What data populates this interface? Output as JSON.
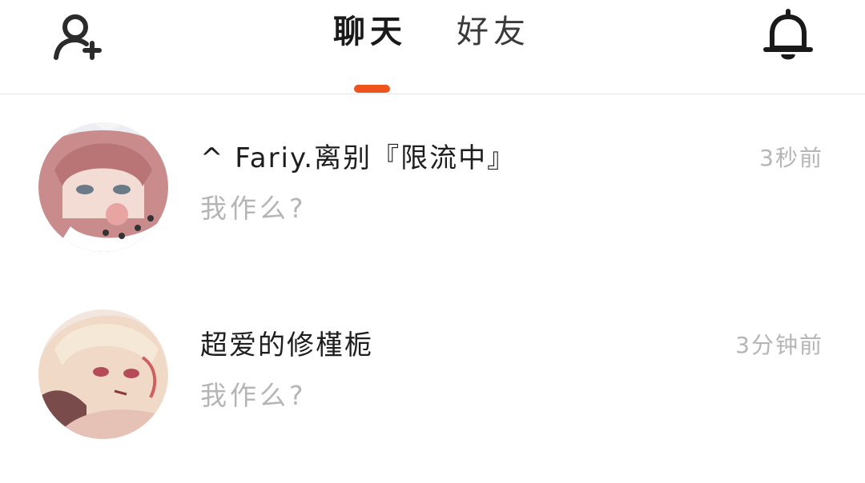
{
  "header": {
    "add_friend_icon": "user-plus-icon",
    "notification_icon": "bell-icon",
    "tabs": [
      {
        "label": "聊天",
        "active": true
      },
      {
        "label": "好友",
        "active": false
      }
    ],
    "accent_color": "#f0541e"
  },
  "conversations": [
    {
      "name": "^ Fariy.离别『限流中』",
      "last_message": "我作么?",
      "time": "3秒前",
      "avatar": "anime-girl-pink-hair-avatar"
    },
    {
      "name": "超爱的修槿栀",
      "last_message": "我作么?",
      "time": "3分钟前",
      "avatar": "anime-boy-blonde-hair-avatar"
    }
  ]
}
